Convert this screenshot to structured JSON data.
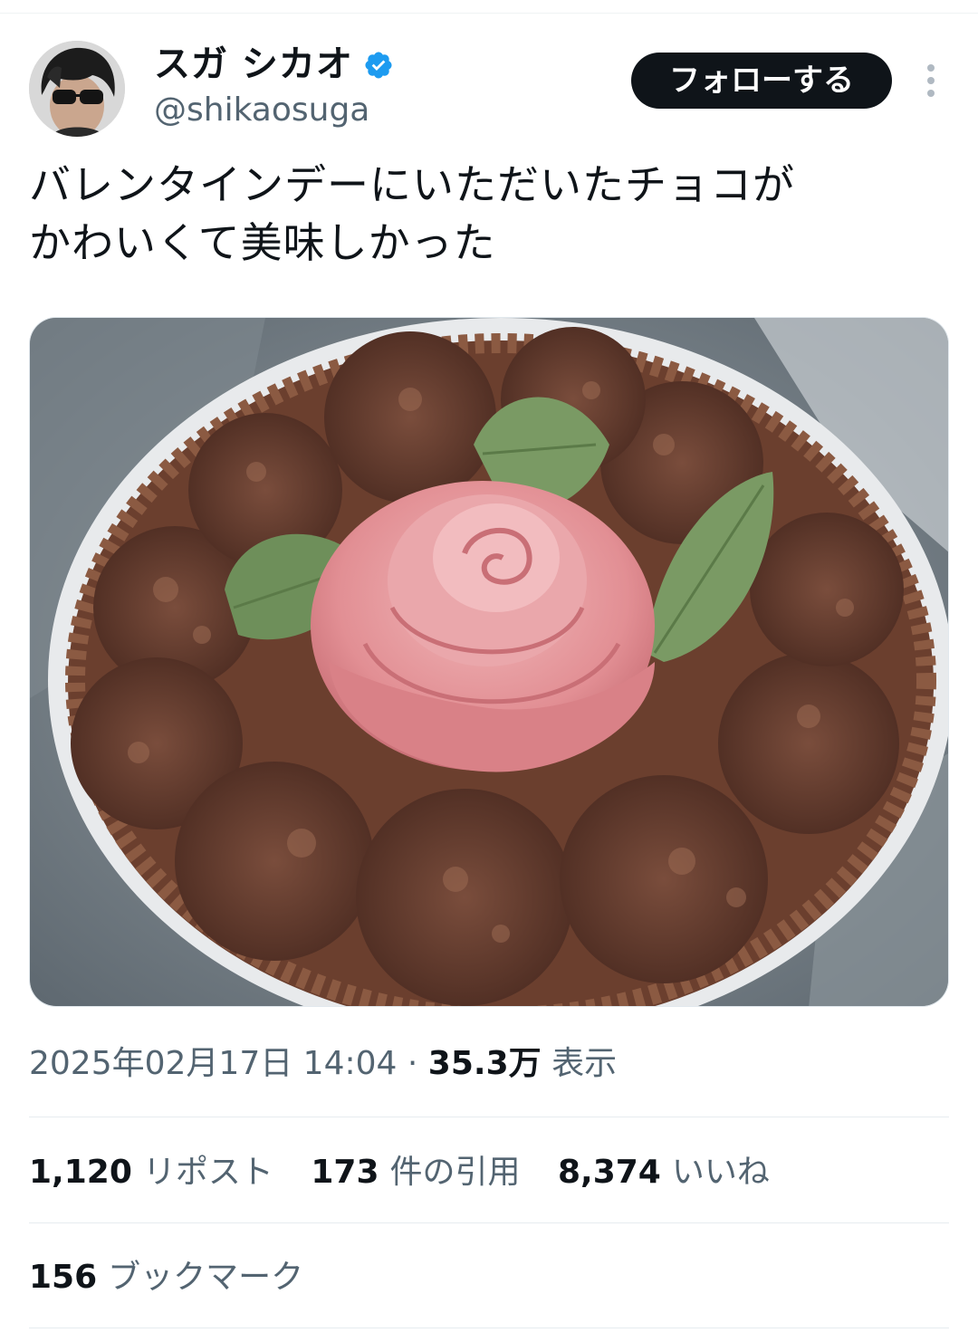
{
  "user": {
    "display_name": "スガ シカオ",
    "handle": "@shikaosuga",
    "verified": true
  },
  "header": {
    "follow_label": "フォローする",
    "more_icon": "more-vertical-icon"
  },
  "tweet": {
    "text_line1": "バレンタインデーにいただいたチョコが",
    "text_line2": "かわいくて美味しかった",
    "timestamp": "2025年02月17日 14:04",
    "separator": "·",
    "views_count": "35.3万",
    "views_label": "表示"
  },
  "stats": {
    "reposts_count": "1,120",
    "reposts_label": "リポスト",
    "quotes_count": "173",
    "quotes_label": "件の引用",
    "likes_count": "8,374",
    "likes_label": "いいね",
    "bookmarks_count": "156",
    "bookmarks_label": "ブックマーク"
  },
  "colors": {
    "verified": "#1d9bf0",
    "button_bg": "#0f1419",
    "secondary_text": "#536471"
  }
}
